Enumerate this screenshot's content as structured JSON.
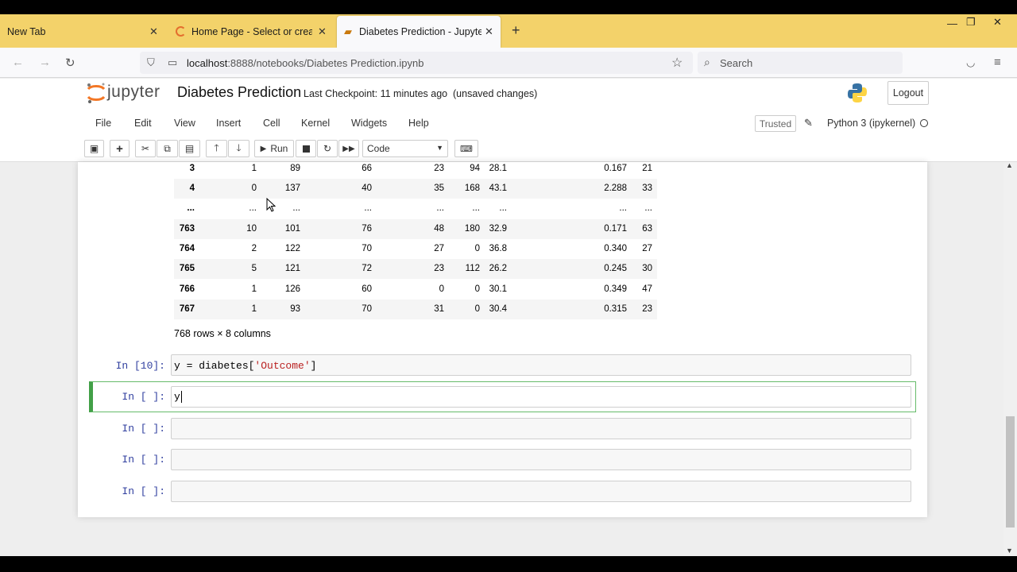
{
  "browser": {
    "tabs": [
      {
        "title": "New Tab"
      },
      {
        "title": "Home Page - Select or create a"
      },
      {
        "title": "Diabetes Prediction - Jupyter N"
      }
    ],
    "url_host": "localhost",
    "url_rest": ":8888/notebooks/Diabetes Prediction.ipynb",
    "search_placeholder": "Search"
  },
  "jupyter": {
    "logo": "jupyter",
    "notebook_title": "Diabetes Prediction",
    "checkpoint": "Last Checkpoint: 11 minutes ago",
    "status": "(unsaved changes)",
    "logout": "Logout",
    "menu": [
      "File",
      "Edit",
      "View",
      "Insert",
      "Cell",
      "Kernel",
      "Widgets",
      "Help"
    ],
    "trusted": "Trusted",
    "kernel": "Python 3 (ipykernel)",
    "run_label": "Run",
    "cell_type": "Code"
  },
  "dataframe": {
    "rows": [
      [
        "3",
        "1",
        "89",
        "66",
        "23",
        "94",
        "28.1",
        "0.167",
        "21"
      ],
      [
        "4",
        "0",
        "137",
        "40",
        "35",
        "168",
        "43.1",
        "2.288",
        "33"
      ],
      [
        "...",
        "...",
        "...",
        "...",
        "...",
        "...",
        "...",
        "...",
        "..."
      ],
      [
        "763",
        "10",
        "101",
        "76",
        "48",
        "180",
        "32.9",
        "0.171",
        "63"
      ],
      [
        "764",
        "2",
        "122",
        "70",
        "27",
        "0",
        "36.8",
        "0.340",
        "27"
      ],
      [
        "765",
        "5",
        "121",
        "72",
        "23",
        "112",
        "26.2",
        "0.245",
        "30"
      ],
      [
        "766",
        "1",
        "126",
        "60",
        "0",
        "0",
        "30.1",
        "0.349",
        "47"
      ],
      [
        "767",
        "1",
        "93",
        "70",
        "31",
        "0",
        "30.4",
        "0.315",
        "23"
      ]
    ],
    "summary": "768 rows × 8 columns"
  },
  "cells": [
    {
      "prompt": "In [10]:",
      "code_var": "y = diabetes[",
      "code_str": "'Outcome'",
      "code_end": "]"
    },
    {
      "prompt": "In [ ]:",
      "code": "y"
    },
    {
      "prompt": "In [ ]:",
      "code": ""
    },
    {
      "prompt": "In [ ]:",
      "code": ""
    },
    {
      "prompt": "In [ ]:",
      "code": ""
    }
  ]
}
